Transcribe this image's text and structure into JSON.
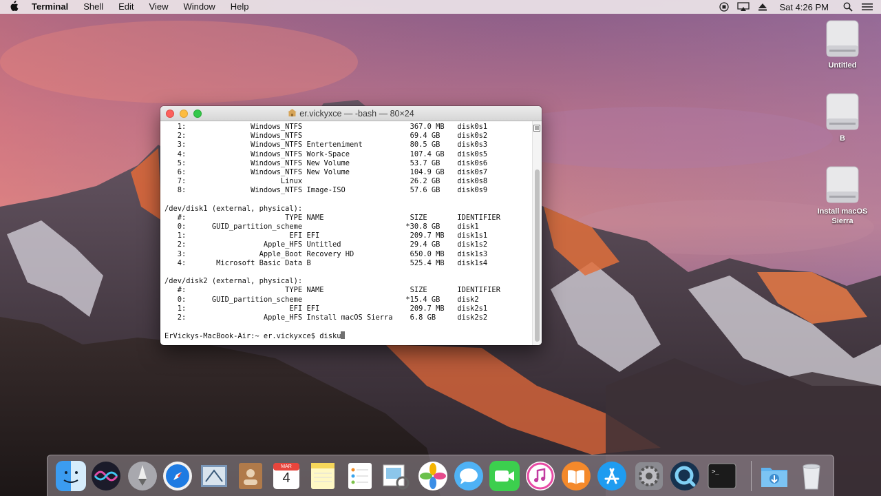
{
  "menubar": {
    "app_name": "Terminal",
    "menus": [
      "Shell",
      "Edit",
      "View",
      "Window",
      "Help"
    ],
    "clock": "Sat 4:26 PM",
    "status_icons": [
      "record-icon",
      "airplay-icon",
      "eject-icon"
    ]
  },
  "desktop_icons": [
    {
      "label": "Untitled"
    },
    {
      "label": "B"
    },
    {
      "label": "Install macOS Sierra"
    }
  ],
  "terminal": {
    "title": "er.vickyxce — -bash — 80×24",
    "lines": [
      "   1:               Windows_NTFS                         367.0 MB   disk0s1",
      "   2:               Windows_NTFS                         69.4 GB    disk0s2",
      "   3:               Windows_NTFS Enterteniment           80.5 GB    disk0s3",
      "   4:               Windows_NTFS Work-Space              107.4 GB   disk0s5",
      "   5:               Windows_NTFS New Volume              53.7 GB    disk0s6",
      "   6:               Windows_NTFS New Volume              104.9 GB   disk0s7",
      "   7:                      Linux                         26.2 GB    disk0s8",
      "   8:               Windows_NTFS Image-ISO               57.6 GB    disk0s9",
      "",
      "/dev/disk1 (external, physical):",
      "   #:                       TYPE NAME                    SIZE       IDENTIFIER",
      "   0:      GUID_partition_scheme                        *30.8 GB    disk1",
      "   1:                        EFI EFI                     209.7 MB   disk1s1",
      "   2:                  Apple_HFS Untitled                29.4 GB    disk1s2",
      "   3:                 Apple_Boot Recovery HD             650.0 MB   disk1s3",
      "   4:       Microsoft Basic Data B                       525.4 MB   disk1s4",
      "",
      "/dev/disk2 (external, physical):",
      "   #:                       TYPE NAME                    SIZE       IDENTIFIER",
      "   0:      GUID_partition_scheme                        *15.4 GB    disk2",
      "   1:                        EFI EFI                     209.7 MB   disk2s1",
      "   2:                  Apple_HFS Install macOS Sierra    6.8 GB     disk2s2",
      "",
      "ErVickys-MacBook-Air:~ er.vickyxce$ disku"
    ]
  },
  "dock": {
    "items": [
      "finder-icon",
      "siri-icon",
      "launchpad-icon",
      "safari-icon",
      "mail-icon",
      "contacts-icon",
      "calendar-icon",
      "notes-icon",
      "reminders-icon",
      "preview-icon",
      "photos-icon",
      "messages-icon",
      "facetime-icon",
      "itunes-icon",
      "ibooks-icon",
      "app-store-icon",
      "system-preferences-icon",
      "quicktime-icon",
      "terminal-icon",
      "downloads-folder-icon",
      "trash-icon"
    ],
    "calendar_month": "MAR",
    "calendar_day": "4"
  },
  "colors": {
    "close": "#fc605c",
    "minimize": "#fdbc40",
    "maximize": "#34c84a"
  }
}
